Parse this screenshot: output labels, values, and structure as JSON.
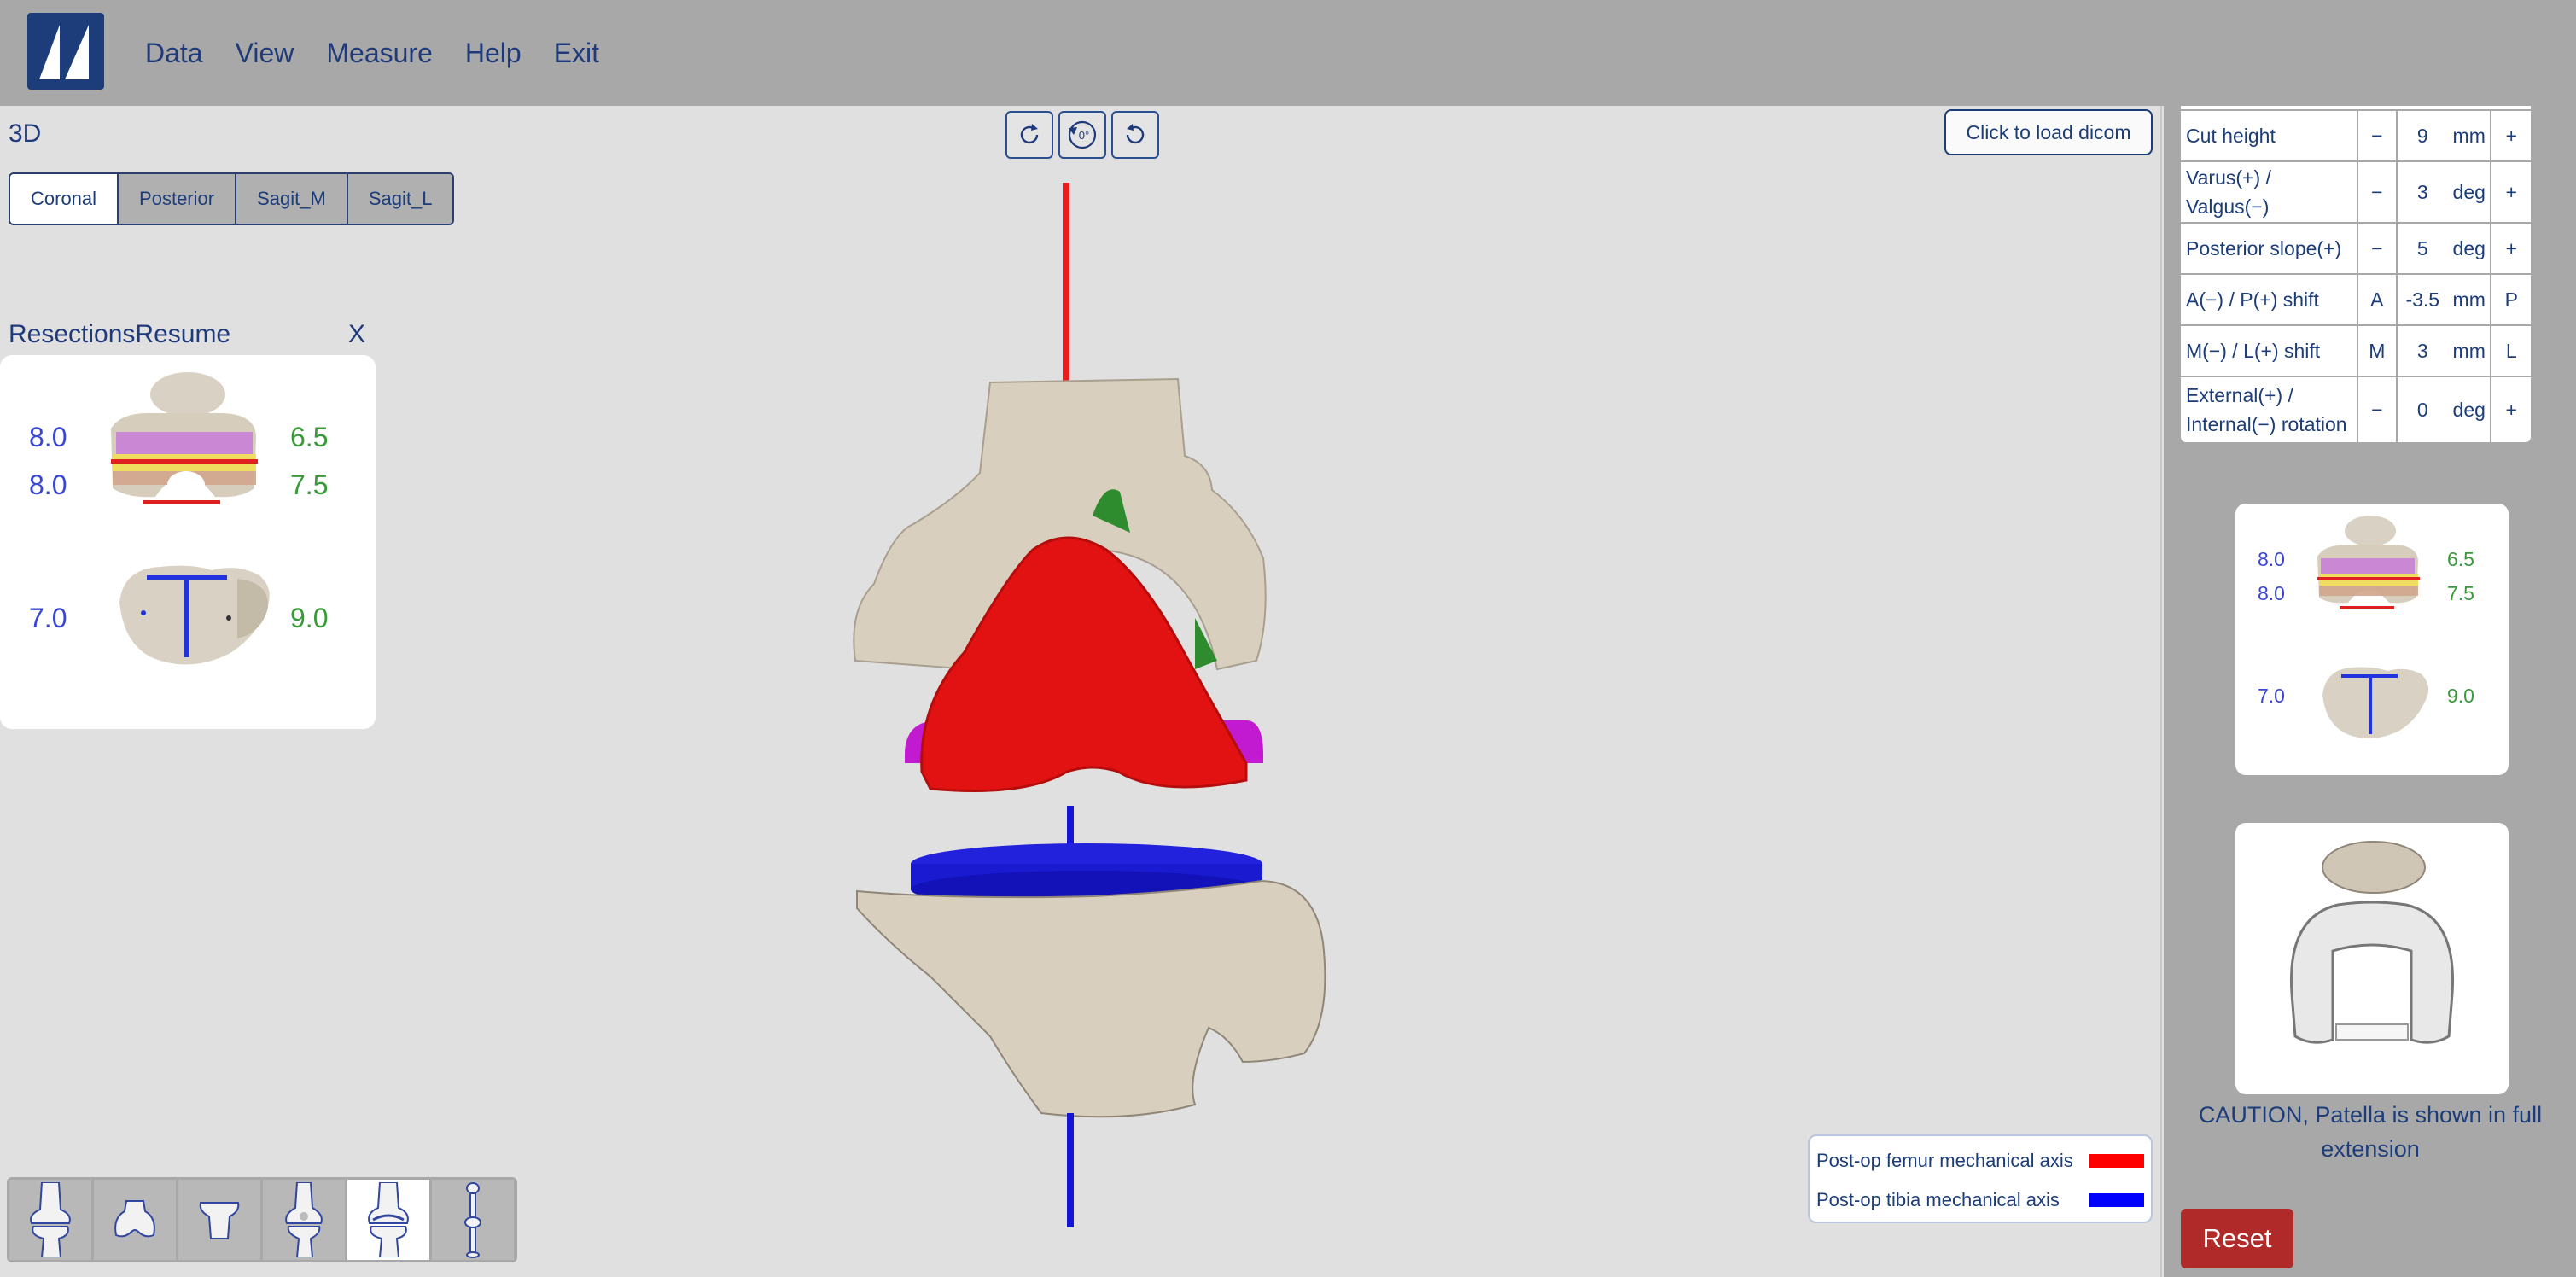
{
  "menu": [
    "Data",
    "View",
    "Measure",
    "Help",
    "Exit"
  ],
  "viewport": {
    "title": "3D",
    "rotation_label": "0°",
    "load_button": "Click to load dicom",
    "tabs": [
      "Coronal",
      "Posterior",
      "Sagit_M",
      "Sagit_L"
    ],
    "active_tab": "Coronal"
  },
  "resections": {
    "title": "ResectionsResume",
    "close": "X",
    "femur_left_top": "8.0",
    "femur_left_bottom": "8.0",
    "femur_right_top": "6.5",
    "femur_right_bottom": "7.5",
    "tibia_left": "7.0",
    "tibia_right": "9.0"
  },
  "toolbar": {
    "icons": [
      "knee-full-icon",
      "femur-distal-icon",
      "tibia-proximal-icon",
      "knee-side-icon",
      "knee-implant-icon",
      "leg-full-icon"
    ],
    "active_index": 4
  },
  "legend": {
    "femur_label": "Post-op femur mechanical axis",
    "tibia_label": "Post-op tibia mechanical axis",
    "femur_color": "#ff0000",
    "tibia_color": "#0000ff"
  },
  "params": [
    {
      "label": "Cut height",
      "minus": "−",
      "value": "9",
      "unit": "mm",
      "plus": "+"
    },
    {
      "label": "Varus(+) / Valgus(−)",
      "minus": "−",
      "value": "3",
      "unit": "deg",
      "plus": "+"
    },
    {
      "label": "Posterior slope(+)",
      "minus": "−",
      "value": "5",
      "unit": "deg",
      "plus": "+"
    },
    {
      "label": "A(−) / P(+) shift",
      "minus": "A",
      "value": "-3.5",
      "unit": "mm",
      "plus": "P"
    },
    {
      "label": "M(−) / L(+) shift",
      "minus": "M",
      "value": "3",
      "unit": "mm",
      "plus": "L"
    },
    {
      "label": "External(+) / Internal(−) rotation",
      "minus": "−",
      "value": "0",
      "unit": "deg",
      "plus": "+"
    }
  ],
  "summary": {
    "femur_left_top": "8.0",
    "femur_left_bottom": "8.0",
    "femur_right_top": "6.5",
    "femur_right_bottom": "7.5",
    "tibia_left": "7.0",
    "tibia_right": "9.0"
  },
  "caution": "CAUTION, Patella is shown in full extension",
  "reset": "Reset"
}
